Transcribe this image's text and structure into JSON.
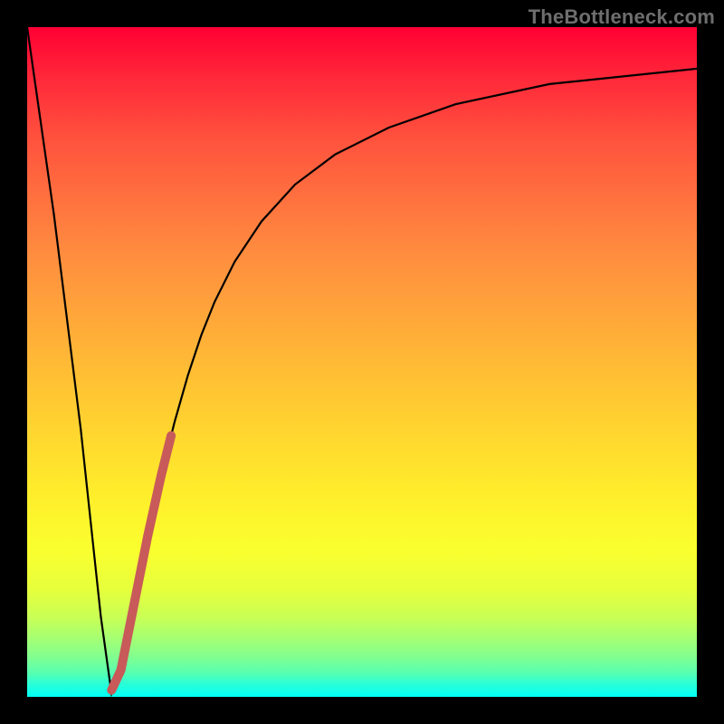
{
  "watermark": "TheBottleneck.com",
  "colors": {
    "background": "#000000",
    "curve": "#000000",
    "highlight": "#c85a5a",
    "gradient_top": "#ff0033",
    "gradient_bottom": "#00fff6"
  },
  "chart_data": {
    "type": "line",
    "title": "",
    "xlabel": "",
    "ylabel": "",
    "xlim": [
      0,
      100
    ],
    "ylim": [
      0,
      100
    ],
    "grid": false,
    "series": [
      {
        "name": "bottleneck-curve",
        "x": [
          0,
          4,
          8,
          11,
          12.6,
          14,
          16,
          18,
          20,
          22,
          24,
          26,
          28,
          31,
          35,
          40,
          46,
          54,
          64,
          78,
          100
        ],
        "values": [
          100,
          72,
          40,
          12,
          0.5,
          4,
          14,
          24,
          33,
          41,
          48,
          54,
          59,
          65,
          71,
          76.5,
          81,
          85,
          88.5,
          91.5,
          93.8
        ]
      },
      {
        "name": "highlight-segment",
        "x": [
          12.6,
          14,
          16,
          18,
          20,
          21.5
        ],
        "values": [
          1,
          4,
          14,
          24,
          33,
          39
        ]
      }
    ],
    "annotations": [
      {
        "text": "TheBottleneck.com",
        "position": "top-right"
      }
    ]
  }
}
